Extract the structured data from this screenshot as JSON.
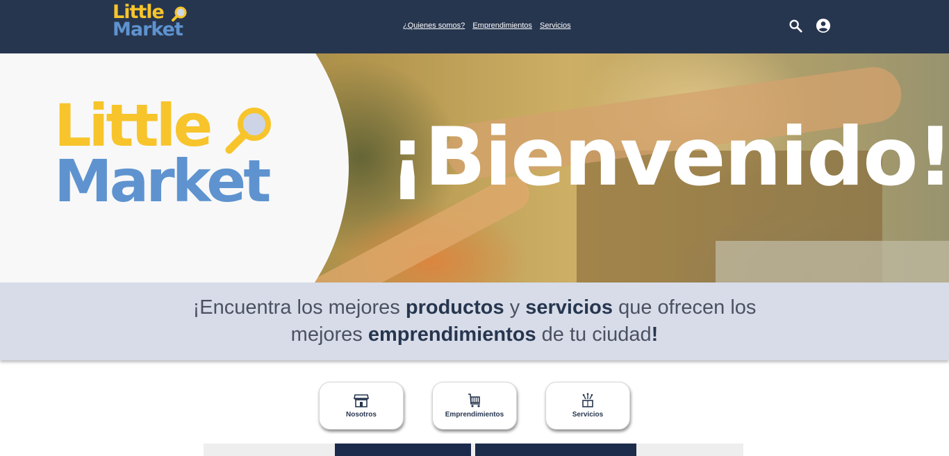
{
  "brand": {
    "line1": "Little",
    "line2": "Market"
  },
  "nav": {
    "items": [
      {
        "label": "¿Quienes somos?"
      },
      {
        "label": "Emprendimientos"
      },
      {
        "label": "Servicios"
      }
    ],
    "search_icon": "search-icon",
    "account_icon": "account-circle-icon"
  },
  "hero": {
    "logo_line1": "Little",
    "logo_line2": "Market",
    "welcome": "¡Bienvenido!"
  },
  "tagline": {
    "line1": {
      "a": "¡Encuentra los mejores ",
      "b": "productos",
      "c": " y ",
      "d": "servicios",
      "e": " que ofrecen los"
    },
    "line2": {
      "a": "mejores ",
      "b": "emprendimientos",
      "c": " de tu ciudad",
      "d": "!"
    }
  },
  "cards": [
    {
      "label": "Nosotros",
      "icon": "storefront-icon"
    },
    {
      "label": "Emprendimientos",
      "icon": "shopping-cart-icon"
    },
    {
      "label": "Servicios",
      "icon": "services-hand-icon"
    }
  ],
  "colors": {
    "header": "#27364f",
    "brand_yellow": "#f7c52b",
    "brand_blue": "#5e93cf",
    "tagline_bg": "#d7dce8"
  }
}
